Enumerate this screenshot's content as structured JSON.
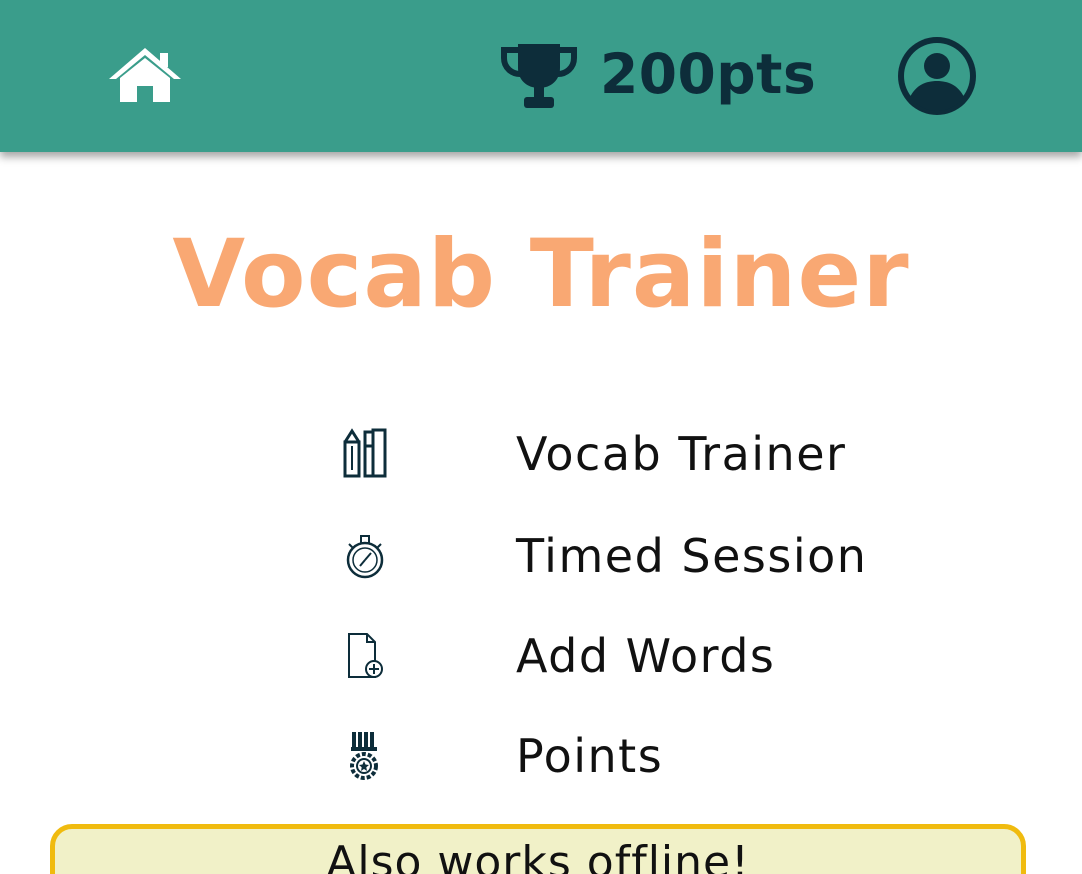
{
  "header": {
    "home_icon": "home-icon",
    "trophy_icon": "trophy-icon",
    "points": "200pts",
    "profile_icon": "user-circle-icon",
    "background_color": "#3a9d8b",
    "text_color": "#0d2d3a"
  },
  "main": {
    "title": "Vocab Trainer",
    "title_color": "#f9a873",
    "menu": [
      {
        "label": "Vocab Trainer",
        "icon": "books-icon"
      },
      {
        "label": "Timed Session",
        "icon": "stopwatch-icon"
      },
      {
        "label": "Add Words",
        "icon": "add-file-icon"
      },
      {
        "label": "Points",
        "icon": "medal-icon"
      }
    ]
  },
  "banner": {
    "text": "Also works offline!",
    "background_color": "#f1f1c8",
    "border_color": "#f0bb0f"
  }
}
